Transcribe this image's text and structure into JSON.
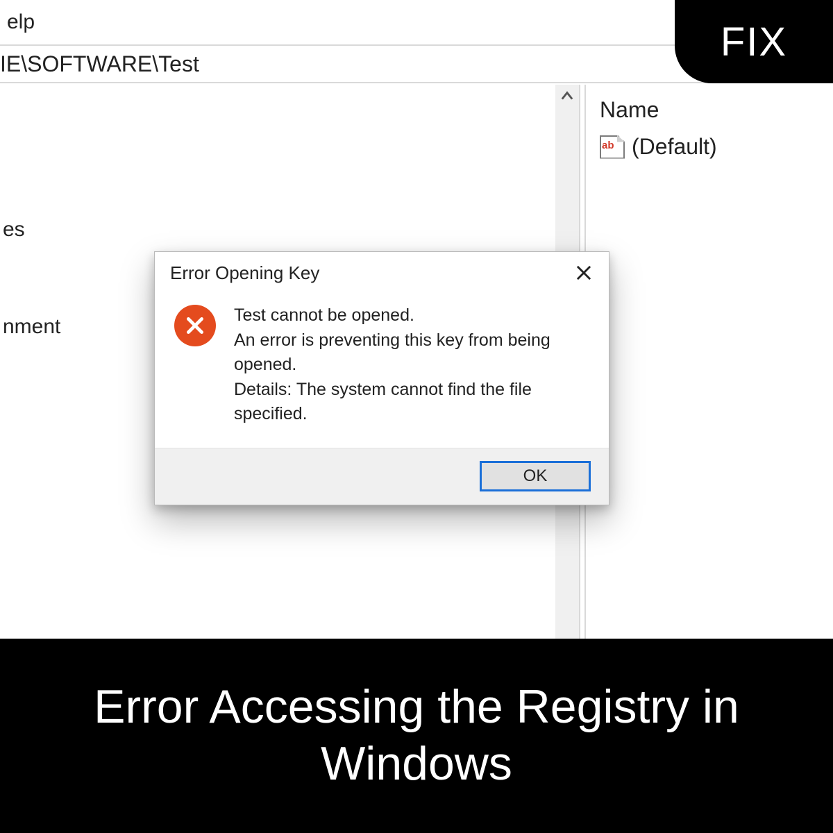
{
  "badge": {
    "label": "FIX"
  },
  "menu": {
    "help": "elp"
  },
  "address_bar": {
    "path": "IE\\SOFTWARE\\Test"
  },
  "tree": {
    "item1": "es",
    "item2": "nment"
  },
  "values_pane": {
    "column_name": "Name",
    "default_value": "(Default)"
  },
  "dialog": {
    "title": "Error Opening Key",
    "line1": "Test cannot be opened.",
    "line2": "An error is preventing this key from being opened.",
    "line3": "Details: The system cannot find the file specified.",
    "ok": "OK"
  },
  "caption": {
    "text": "Error Accessing the Registry in Windows"
  }
}
